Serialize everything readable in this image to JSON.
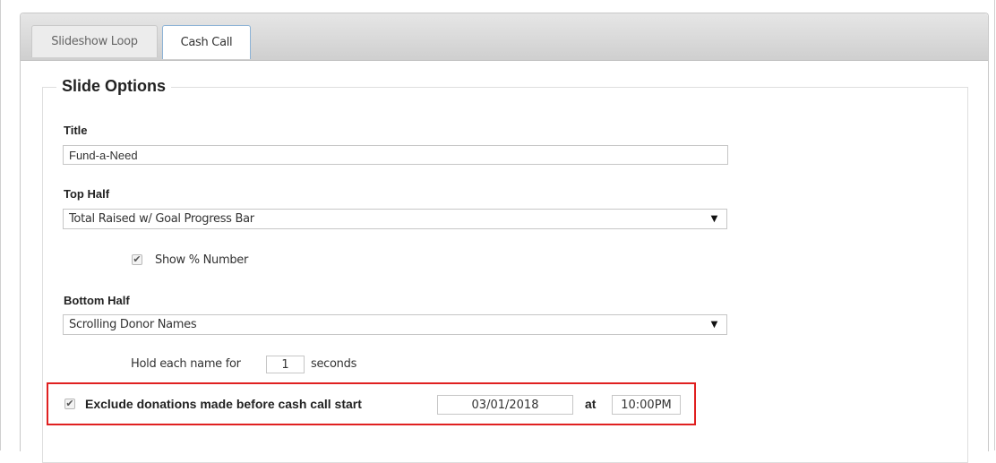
{
  "tabs": [
    {
      "label": "Slideshow Loop",
      "active": false
    },
    {
      "label": "Cash Call",
      "active": true
    }
  ],
  "section": {
    "legend": "Slide Options"
  },
  "title_field": {
    "label": "Title",
    "value": "Fund-a-Need"
  },
  "top_half": {
    "label": "Top Half",
    "selected": "Total Raised w/ Goal Progress Bar",
    "show_percent": {
      "label": "Show % Number",
      "checked": true
    }
  },
  "bottom_half": {
    "label": "Bottom Half",
    "selected": "Scrolling Donor Names",
    "hold": {
      "prefix": "Hold each name for",
      "value": "1",
      "suffix": "seconds"
    }
  },
  "exclude": {
    "checked": true,
    "label": "Exclude donations made before cash call start",
    "date": "03/01/2018",
    "at_label": "at",
    "time": "10:00PM"
  },
  "colors": {
    "highlight": "#e02020",
    "active_tab_border": "#8db3d6"
  }
}
